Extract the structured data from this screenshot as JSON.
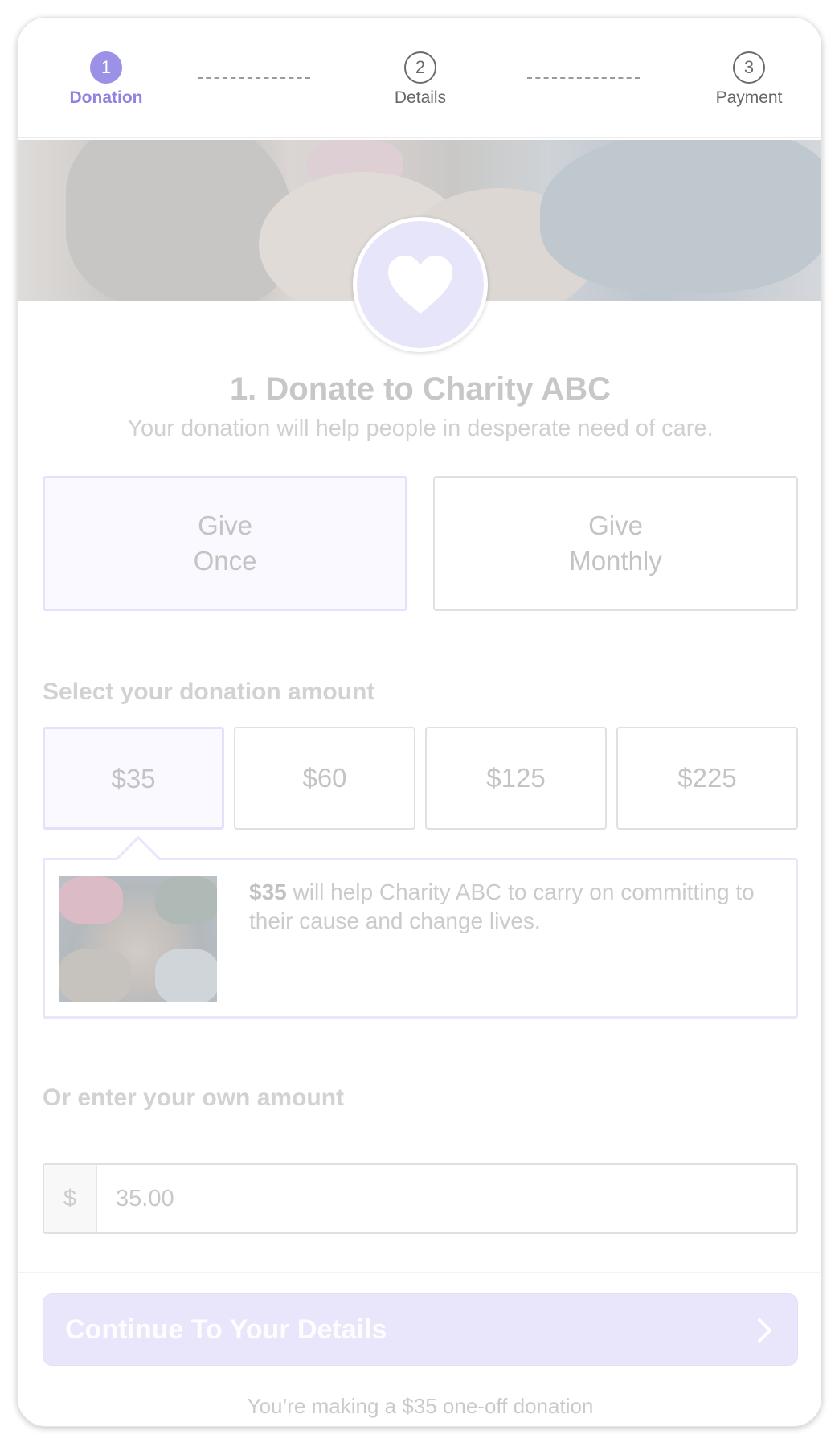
{
  "stepper": {
    "steps": [
      {
        "number": "1",
        "label": "Donation"
      },
      {
        "number": "2",
        "label": "Details"
      },
      {
        "number": "3",
        "label": "Payment"
      }
    ],
    "active_step": 1
  },
  "header": {
    "title": "1. Donate to Charity ABC",
    "subtitle": "Your donation will help people in desperate need of care."
  },
  "frequency": {
    "options": [
      {
        "line1": "Give",
        "line2": "Once"
      },
      {
        "line1": "Give",
        "line2": "Monthly"
      }
    ],
    "selected": "Give Once"
  },
  "amounts": {
    "label": "Select your donation amount",
    "options": [
      "$35",
      "$60",
      "$125",
      "$225"
    ],
    "selected": "$35"
  },
  "impact": {
    "amount": "$35",
    "text": " will help Charity ABC to carry on committing to their cause and change lives."
  },
  "custom_amount": {
    "label": "Or enter your own amount",
    "currency_symbol": "$",
    "value": "35.00"
  },
  "cta": {
    "label": "Continue To Your Details",
    "icon": "chevron-right-icon"
  },
  "footer_note": "You’re making a $35 one-off donation",
  "colors": {
    "accent": "#9b91e6",
    "selected_border": "#e4e1fb",
    "cta_bg": "#e9e6fc"
  }
}
